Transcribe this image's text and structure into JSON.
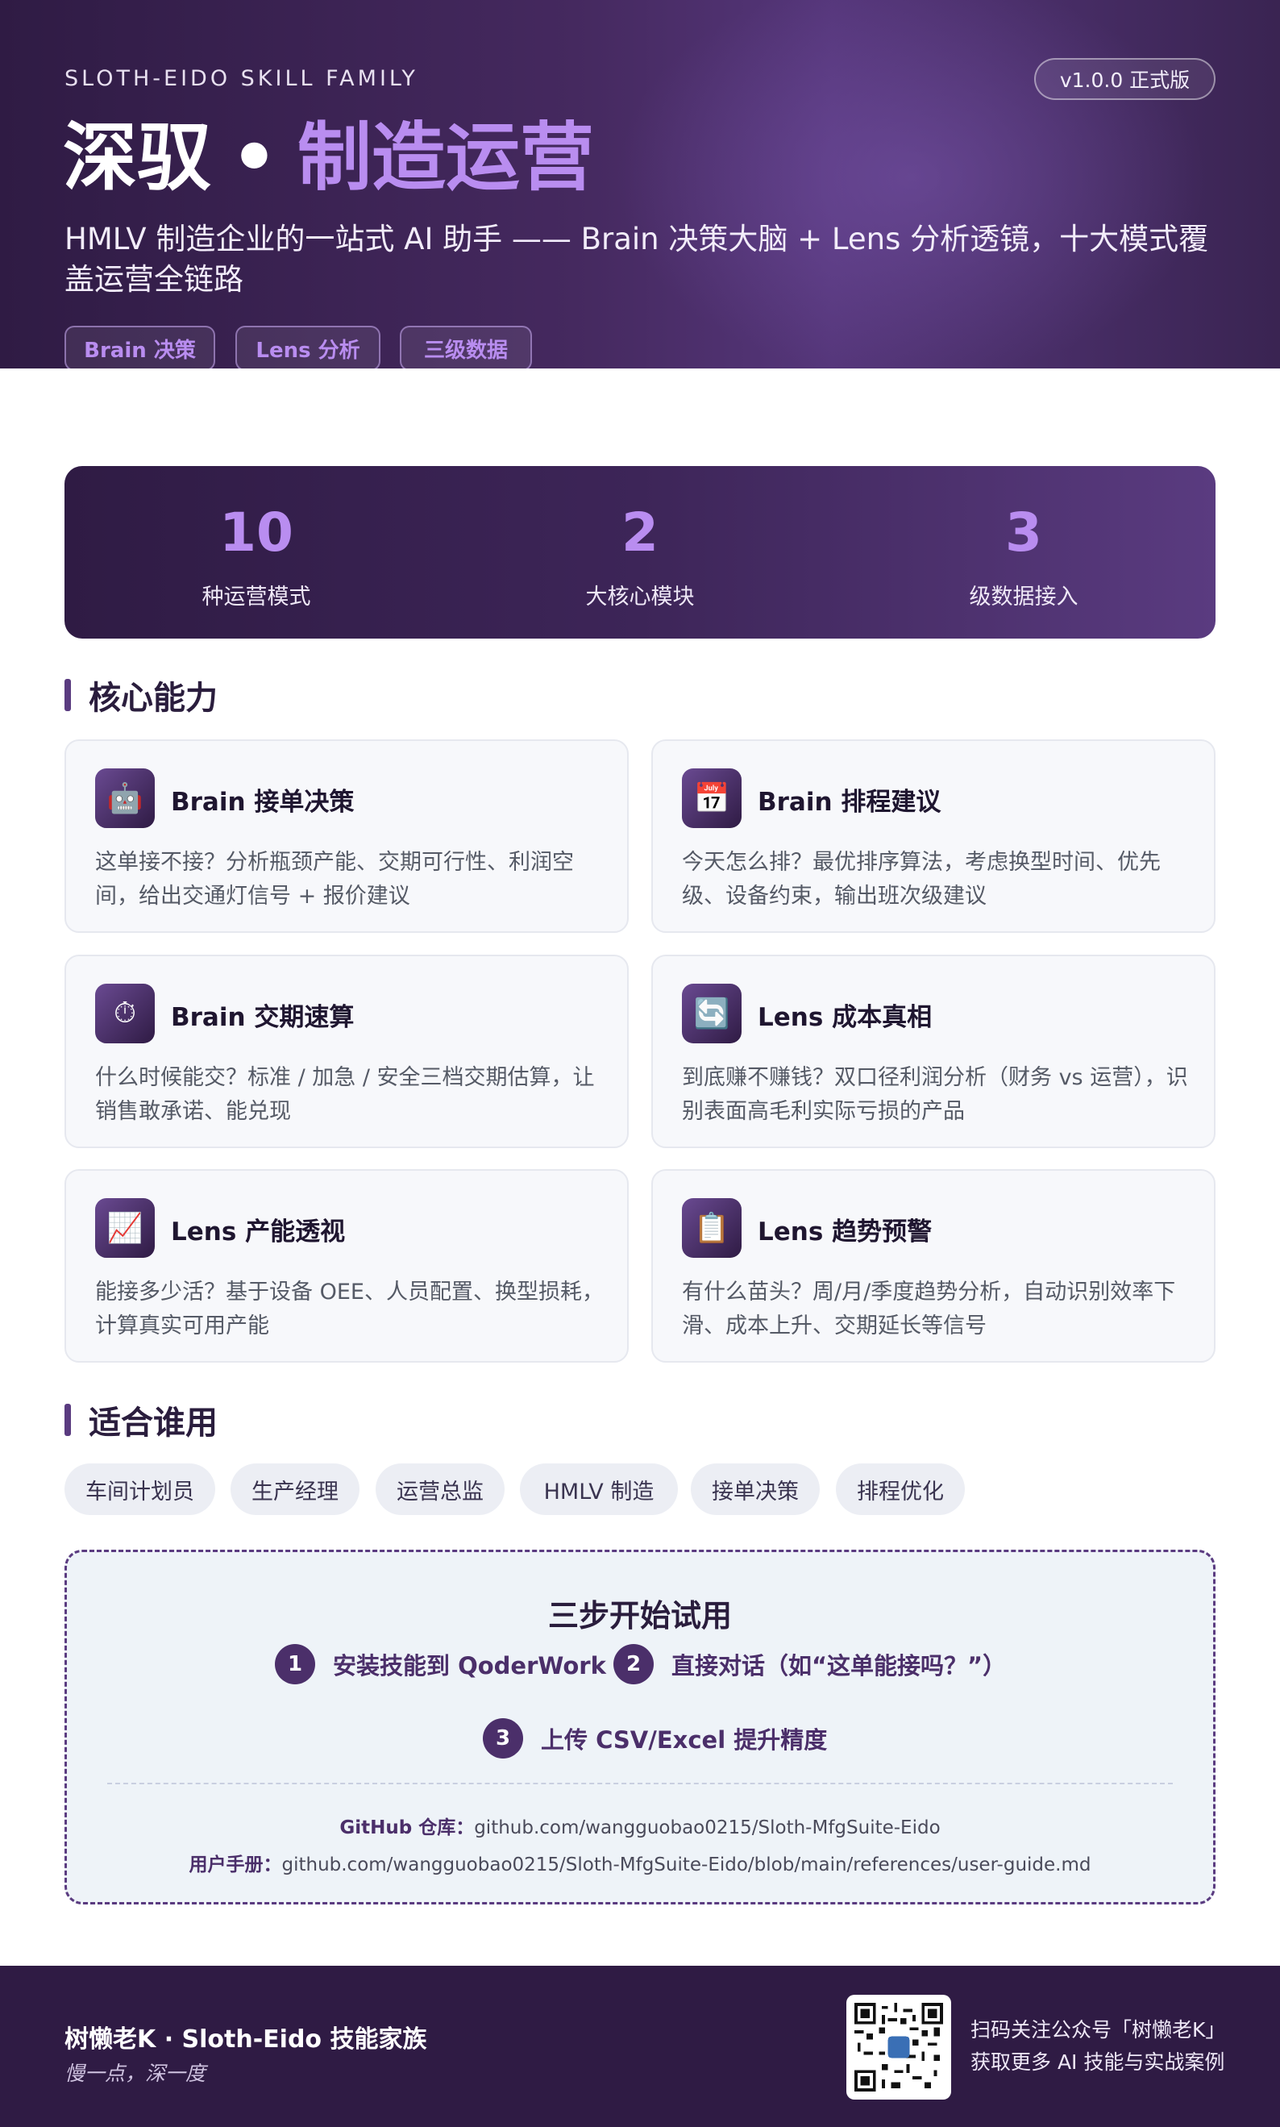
{
  "header": {
    "family": "SLOTH-EIDO SKILL FAMILY",
    "version": "v1.0.0 正式版",
    "title_main": "深驭",
    "title_dot": "•",
    "title_accent": "制造运营",
    "subtitle": "HMLV 制造企业的一站式 AI 助手 —— Brain 决策大脑 + Lens 分析透镜，十大模式覆盖运营全链路",
    "tags": [
      "Brain 决策",
      "Lens 分析",
      "三级数据"
    ],
    "colors": {
      "accent": "#b98df0",
      "brand_dark": "#2f1b44"
    }
  },
  "stats": [
    {
      "value": "10",
      "label": "种运营模式"
    },
    {
      "value": "2",
      "label": "大核心模块"
    },
    {
      "value": "3",
      "label": "级数据接入"
    }
  ],
  "capabilities": {
    "heading": "核心能力",
    "cards": [
      {
        "icon": "robot-icon",
        "title": "Brain 接单决策",
        "desc": "这单接不接？分析瓶颈产能、交期可行性、利润空间，给出交通灯信号 + 报价建议"
      },
      {
        "icon": "calendar-icon",
        "title": "Brain 排程建议",
        "desc": "今天怎么排？最优排序算法，考虑换型时间、优先级、设备约束，输出班次级建议"
      },
      {
        "icon": "stopwatch-icon",
        "title": "Brain 交期速算",
        "desc": "什么时候能交？标准 / 加急 / 安全三档交期估算，让销售敢承诺、能兑现"
      },
      {
        "icon": "refresh-icon",
        "title": "Lens 成本真相",
        "desc": "到底赚不赚钱？双口径利润分析（财务 vs 运营），识别表面高毛利实际亏损的产品"
      },
      {
        "icon": "chart-up-icon",
        "title": "Lens 产能透视",
        "desc": "能接多少活？基于设备 OEE、人员配置、换型损耗，计算真实可用产能"
      },
      {
        "icon": "clipboard-icon",
        "title": "Lens 趋势预警",
        "desc": "有什么苗头？周/月/季度趋势分析，自动识别效率下滑、成本上升、交期延长等信号"
      }
    ]
  },
  "audience": {
    "heading": "适合谁用",
    "chips": [
      "车间计划员",
      "生产经理",
      "运营总监",
      "HMLV 制造",
      "接单决策",
      "排程优化"
    ]
  },
  "trial": {
    "title": "三步开始试用",
    "steps": [
      {
        "num": "1",
        "text": "安装技能到 QoderWork"
      },
      {
        "num": "2",
        "text": "直接对话（如“这单能接吗？”）"
      },
      {
        "num": "3",
        "text": "上传 CSV/Excel 提升精度"
      }
    ],
    "github_label": "GitHub 仓库：",
    "github_url": "github.com/wangguobao0215/Sloth-MfgSuite-Eido",
    "manual_label": "用户手册：",
    "manual_url": "github.com/wangguobao0215/Sloth-MfgSuite-Eido/blob/main/references/user-guide.md"
  },
  "footer": {
    "name": "树懒老K · Sloth-Eido 技能家族",
    "slogan": "慢一点，深一度",
    "qr_icon": "qr-code-icon",
    "qr_text_1": "扫码关注公众号「树懒老K」",
    "qr_text_2": "获取更多 AI 技能与实战案例"
  }
}
